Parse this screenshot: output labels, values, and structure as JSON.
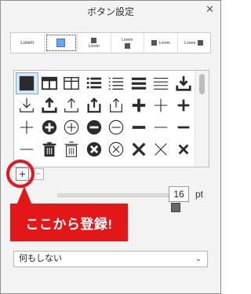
{
  "dialog": {
    "title": "ボタン設定",
    "close_icon": "close-icon"
  },
  "button_styles": [
    {
      "label": "Lorem",
      "kind": "text-only"
    },
    {
      "label": "",
      "kind": "icon-only",
      "selected": true
    },
    {
      "label": "Lorem",
      "kind": "icon-over-text"
    },
    {
      "label": "Lorem",
      "kind": "text-over-icon"
    },
    {
      "label": "Lorem",
      "kind": "icon-left-text"
    },
    {
      "label": "Lorem",
      "kind": "text-left-icon"
    }
  ],
  "icons": [
    "filled-square-icon",
    "table-header-icon",
    "table-icon",
    "bullet-list-icon",
    "dashed-list-icon",
    "thick-lines-icon",
    "thin-lines-icon",
    "download-tray-icon",
    "arrow-down-tray-icon",
    "upload-tray-icon",
    "arrow-up-tray-icon",
    "share-filled-icon",
    "share-outline-icon",
    "plus-bold-icon",
    "plus-thin-icon",
    "plus-medium-icon",
    "plus-thin-icon",
    "plus-circle-filled-icon",
    "plus-circle-outline-icon",
    "minus-circle-filled-icon",
    "minus-circle-outline-icon",
    "minus-bold-icon",
    "minus-thin-icon",
    "minus-medium-icon",
    "minus-thin-icon",
    "trash-filled-icon",
    "trash-outline-icon",
    "x-circle-filled-icon",
    "x-circle-outline-icon",
    "x-bold-icon",
    "x-thin-icon",
    "x-medium-icon",
    "arrow-partial-icon",
    "arrow-partial-icon",
    "arrow-partial-icon",
    "arrow-partial-icon",
    "arrow-partial-icon",
    "arrow-partial-icon",
    "arrow-partial-icon",
    "arrow-partial-icon"
  ],
  "selected_icon_index": 0,
  "controls": {
    "add_label": "+",
    "remove_label": "−",
    "size_value": "16",
    "size_unit": "pt"
  },
  "callout": {
    "text": "ここから登録!"
  },
  "action_select": {
    "value": "何もしない"
  },
  "colors": {
    "highlight": "#e41718",
    "selection": "#6aa5ea"
  }
}
